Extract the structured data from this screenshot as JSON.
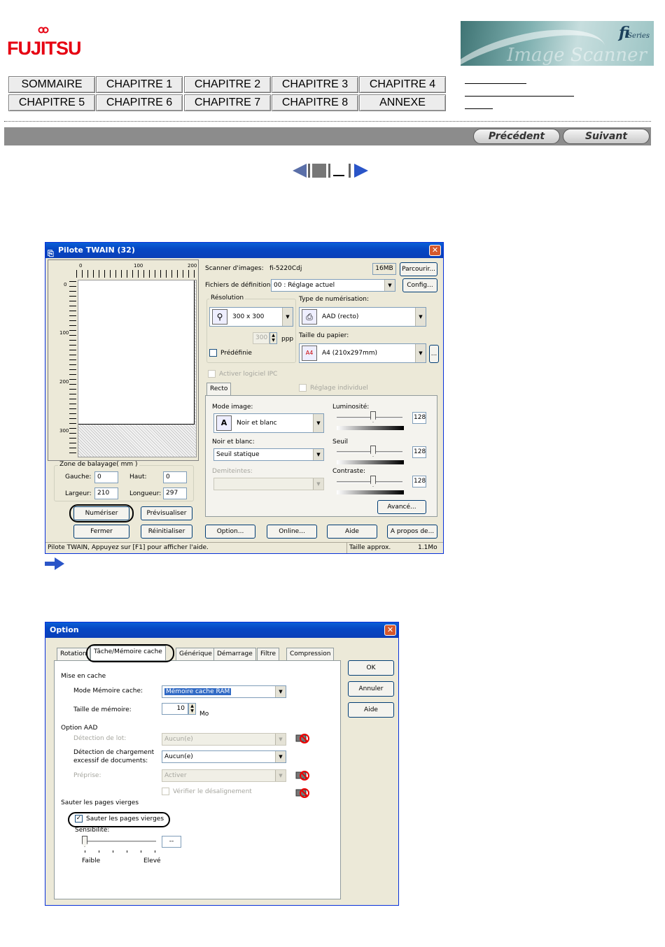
{
  "header": {
    "logo_text": "FUJITSU",
    "banner_brand": "fi",
    "banner_series": "Series",
    "banner_ghost": "Image Scanner",
    "nav": [
      {
        "label": "SOMMAIRE"
      },
      {
        "label": "CHAPITRE 1"
      },
      {
        "label": "CHAPITRE 2"
      },
      {
        "label": "CHAPITRE 3"
      },
      {
        "label": "CHAPITRE 4"
      },
      {
        "label": "CHAPITRE 5"
      },
      {
        "label": "CHAPITRE 6"
      },
      {
        "label": "CHAPITRE 7"
      },
      {
        "label": "CHAPITRE 8"
      },
      {
        "label": "ANNEXE"
      }
    ],
    "prev_label": "Précédent",
    "next_label": "Suivant"
  },
  "twain": {
    "title": "Pilote TWAIN (32)",
    "ruler_top": [
      "0",
      "100",
      "200"
    ],
    "ruler_left": [
      "0",
      "100",
      "200",
      "300"
    ],
    "scanner_label": "Scanner d'images:",
    "scanner_value": "fi-5220Cdj",
    "memory_badge": "16MB",
    "browse_btn": "Parcourir...",
    "deffile_label": "Fichiers de définition:",
    "deffile_value": "00 : Réglage actuel",
    "config_btn": "Config...",
    "resolution_group": "Résolution",
    "resolution_value": "300 x 300",
    "dpi_value": "300",
    "dpi_unit": "ppp",
    "predefined_label": "Prédéfinie",
    "scan_type_group": "Type de numérisation:",
    "scan_type_value": "AAD (recto)",
    "paper_size_label": "Taille du papier:",
    "paper_size_value": "A4 (210x297mm)",
    "paper_more_btn": "...",
    "ipc_label": "Activer logiciel IPC",
    "tab_recto": "Recto",
    "individual_label": "Réglage individuel",
    "image_mode_label": "Mode image:",
    "image_mode_value": "Noir et blanc",
    "bw_label": "Noir et blanc:",
    "bw_value": "Seuil statique",
    "halftone_label": "Demiteintes:",
    "brightness_label": "Luminosité:",
    "brightness_value": "128",
    "threshold_label": "Seuil",
    "threshold_value": "128",
    "contrast_label": "Contraste:",
    "contrast_value": "128",
    "advanced_btn": "Avancé...",
    "zone_group": "Zone de balayage( mm )",
    "left_label": "Gauche:",
    "left_value": "0",
    "top_label": "Haut:",
    "top_value": "0",
    "width_label": "Largeur:",
    "width_value": "210",
    "length_label": "Longueur:",
    "length_value": "297",
    "scan_btn": "Numériser",
    "preview_btn": "Prévisualiser",
    "close_btn": "Fermer",
    "reset_btn": "Réinitialiser",
    "option_btn": "Option...",
    "online_btn": "Online...",
    "help_btn": "Aide",
    "about_btn": "A propos de...",
    "status_text": "Pilote TWAIN, Appuyez sur [F1] pour afficher l'aide.",
    "approx_size_label": "Taille approx.",
    "approx_size_value": "1.1Mo"
  },
  "option": {
    "title": "Option",
    "tabs": [
      {
        "label": "Rotation"
      },
      {
        "label": "Tâche/Mémoire cache"
      },
      {
        "label": "Générique"
      },
      {
        "label": "Démarrage"
      },
      {
        "label": "Filtre"
      },
      {
        "label": "Compression"
      }
    ],
    "ok_btn": "OK",
    "cancel_btn": "Annuler",
    "help_btn": "Aide",
    "cache_section": "Mise en cache",
    "cache_mode_label": "Mode Mémoire cache:",
    "cache_mode_value": "Mémoire cache RAM",
    "mem_size_label": "Taille de mémoire:",
    "mem_size_value": "10",
    "mem_unit": "Mo",
    "aad_section": "Option AAD",
    "batch_label": "Détection de lot:",
    "batch_value": "Aucun(e)",
    "overload_label_1": "Détection de chargement",
    "overload_label_2": "excessif de documents:",
    "overload_value": "Aucun(e)",
    "prepick_label": "Préprise:",
    "prepick_value": "Activer",
    "skew_label": "Vérifier le désalignement",
    "skip_section": "Sauter les pages vierges",
    "skip_check_label": "Sauter les pages vierges",
    "sensitivity_label": "Sensibilité:",
    "sensitivity_value": "--",
    "low_label": "Faible",
    "high_label": "Elevé"
  }
}
